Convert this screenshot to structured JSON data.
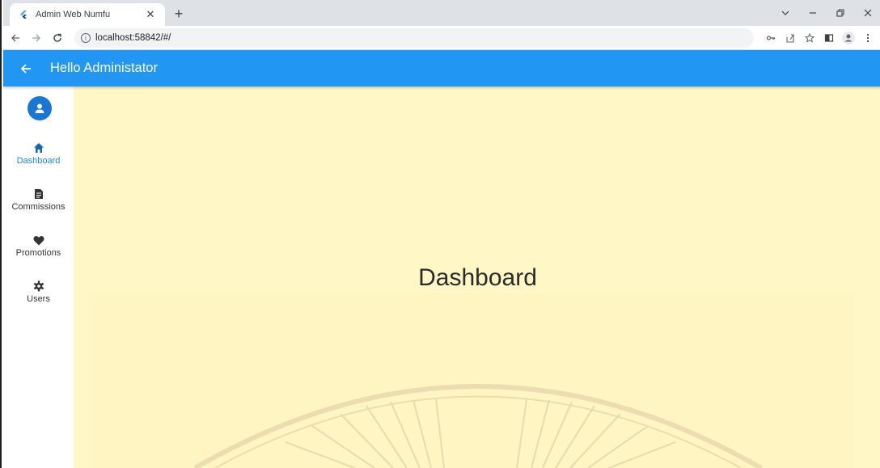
{
  "browser": {
    "tab_title": "Admin Web Numfu",
    "tab_close_icon": "close-icon",
    "new_tab_icon": "plus-icon",
    "url": "localhost:58842/#/",
    "window_controls": [
      "chevron-down-icon",
      "minimize-icon",
      "restore-icon",
      "close-icon"
    ],
    "toolbar_icons": [
      "key-icon",
      "share-icon",
      "star-icon",
      "side-panel-icon",
      "profile-icon",
      "more-icon"
    ]
  },
  "appbar": {
    "title": "Hello Administator",
    "back_icon": "arrow-back-icon",
    "color": "#2196f3"
  },
  "rail": {
    "avatar_icon": "person-icon",
    "items": [
      {
        "label": "Dashboard",
        "icon": "home-icon",
        "active": true
      },
      {
        "label": "Commissions",
        "icon": "document-icon",
        "active": false
      },
      {
        "label": "Promotions",
        "icon": "heart-icon",
        "active": false
      },
      {
        "label": "Users",
        "icon": "gear-icon",
        "active": false
      }
    ]
  },
  "main": {
    "title": "Dashboard",
    "background": "#fff7c5"
  }
}
